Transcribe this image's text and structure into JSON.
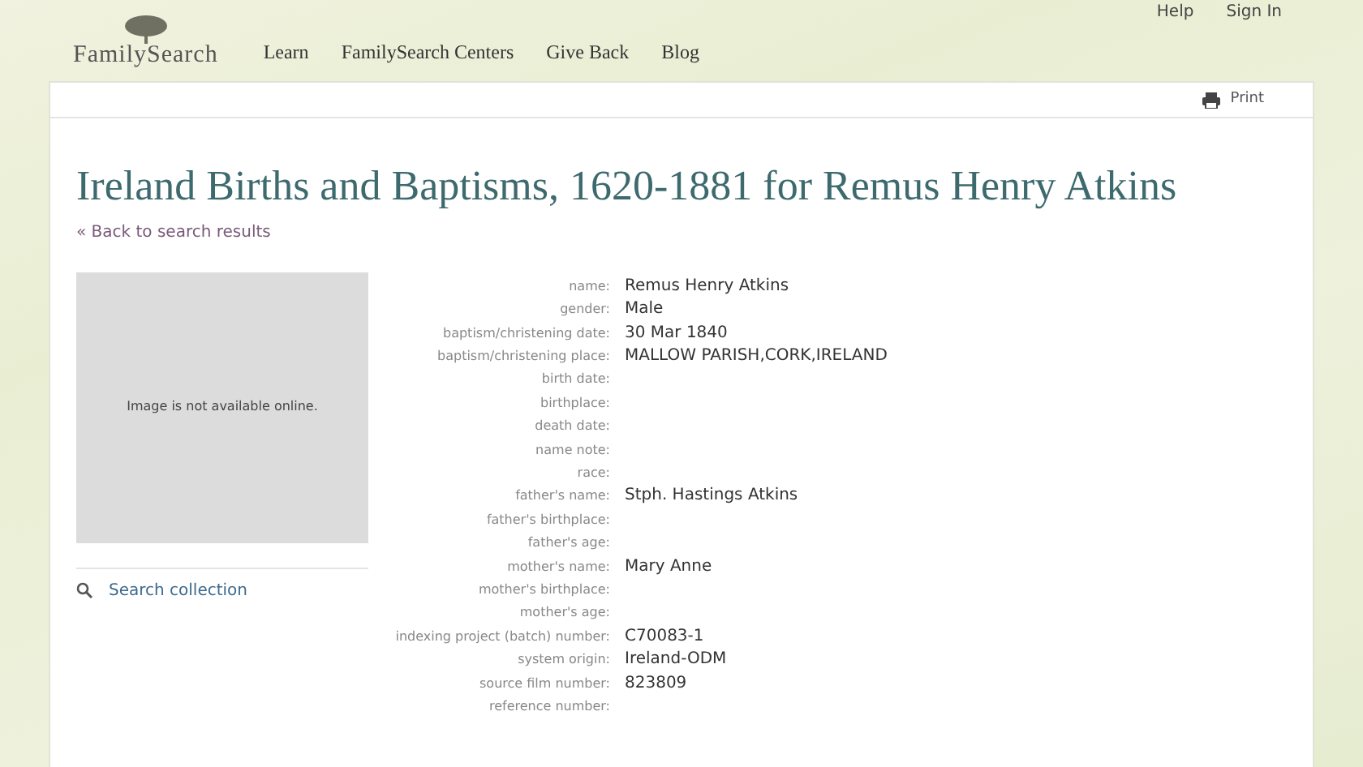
{
  "top_links": [
    "Help",
    "Sign In"
  ],
  "logo": "FamilySearch",
  "nav": [
    "Learn",
    "FamilySearch Centers",
    "Give Back",
    "Blog"
  ],
  "print": "Print",
  "title": "Ireland Births and Baptisms, 1620-1881 for Remus Henry Atkins",
  "back_link": "« Back to search results",
  "image_note": "Image is not available online.",
  "search_collection": "Search collection",
  "fields": [
    {
      "label": "name:",
      "value": "Remus Henry Atkins"
    },
    {
      "label": "gender:",
      "value": "Male"
    },
    {
      "label": "baptism/christening date:",
      "value": "30 Mar 1840"
    },
    {
      "label": "baptism/christening place:",
      "value": "MALLOW PARISH,CORK,IRELAND"
    },
    {
      "label": "birth date:"
    },
    {
      "label": "birthplace:"
    },
    {
      "label": "death date:"
    },
    {
      "label": "name note:"
    },
    {
      "label": "race:"
    },
    {
      "label": "father's name:",
      "value": "Stph. Hastings Atkins"
    },
    {
      "label": "father's birthplace:"
    },
    {
      "label": "father's age:"
    },
    {
      "label": "mother's name:",
      "value": "Mary Anne"
    },
    {
      "label": "mother's birthplace:"
    },
    {
      "label": "mother's age:"
    },
    {
      "label": "indexing project (batch) number:",
      "value": "C70083-1"
    },
    {
      "label": "system origin:",
      "value": "Ireland-ODM"
    },
    {
      "label": "source film number:",
      "value": "823809"
    },
    {
      "label": "reference number:"
    }
  ]
}
